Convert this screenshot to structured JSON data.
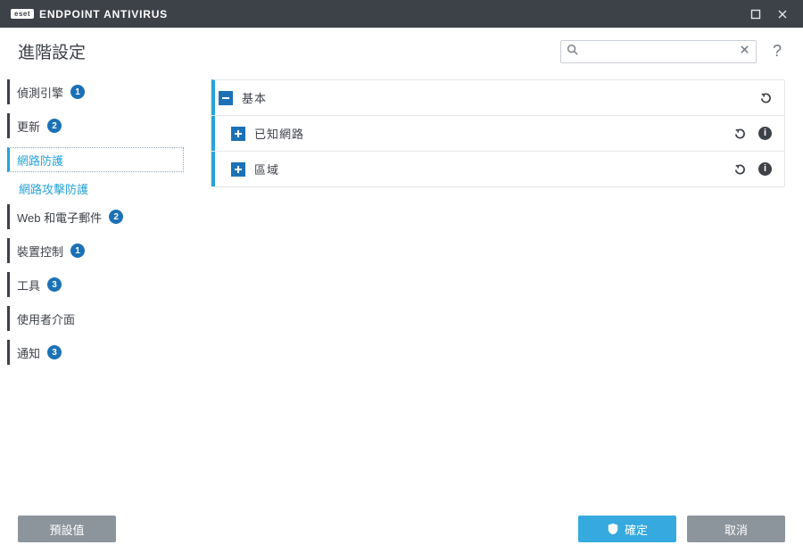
{
  "titlebar": {
    "brand": "eset",
    "product": "ENDPOINT ANTIVIRUS"
  },
  "page_title": "進階設定",
  "search": {
    "value": "",
    "placeholder": ""
  },
  "help_label": "?",
  "sidebar": {
    "items": [
      {
        "label": "偵測引擎",
        "badge": "1",
        "accent": true
      },
      {
        "label": "更新",
        "badge": "2",
        "accent": true
      },
      {
        "label": "網路防護",
        "badge": "",
        "accent": true,
        "selected": true
      },
      {
        "label": "網路攻擊防護",
        "badge": "",
        "child": true
      },
      {
        "label": "Web 和電子郵件",
        "badge": "2",
        "accent": true
      },
      {
        "label": "裝置控制",
        "badge": "1",
        "accent": true
      },
      {
        "label": "工具",
        "badge": "3",
        "accent": true
      },
      {
        "label": "使用者介面",
        "badge": "",
        "accent": true
      },
      {
        "label": "通知",
        "badge": "3",
        "accent": true
      }
    ]
  },
  "sections": [
    {
      "label": "基本",
      "expanded": true,
      "undo": true,
      "info": false
    },
    {
      "label": "已知網路",
      "expanded": false,
      "undo": true,
      "info": true
    },
    {
      "label": "區域",
      "expanded": false,
      "undo": true,
      "info": true
    }
  ],
  "footer": {
    "defaults": "預設值",
    "ok": "確定",
    "cancel": "取消"
  }
}
